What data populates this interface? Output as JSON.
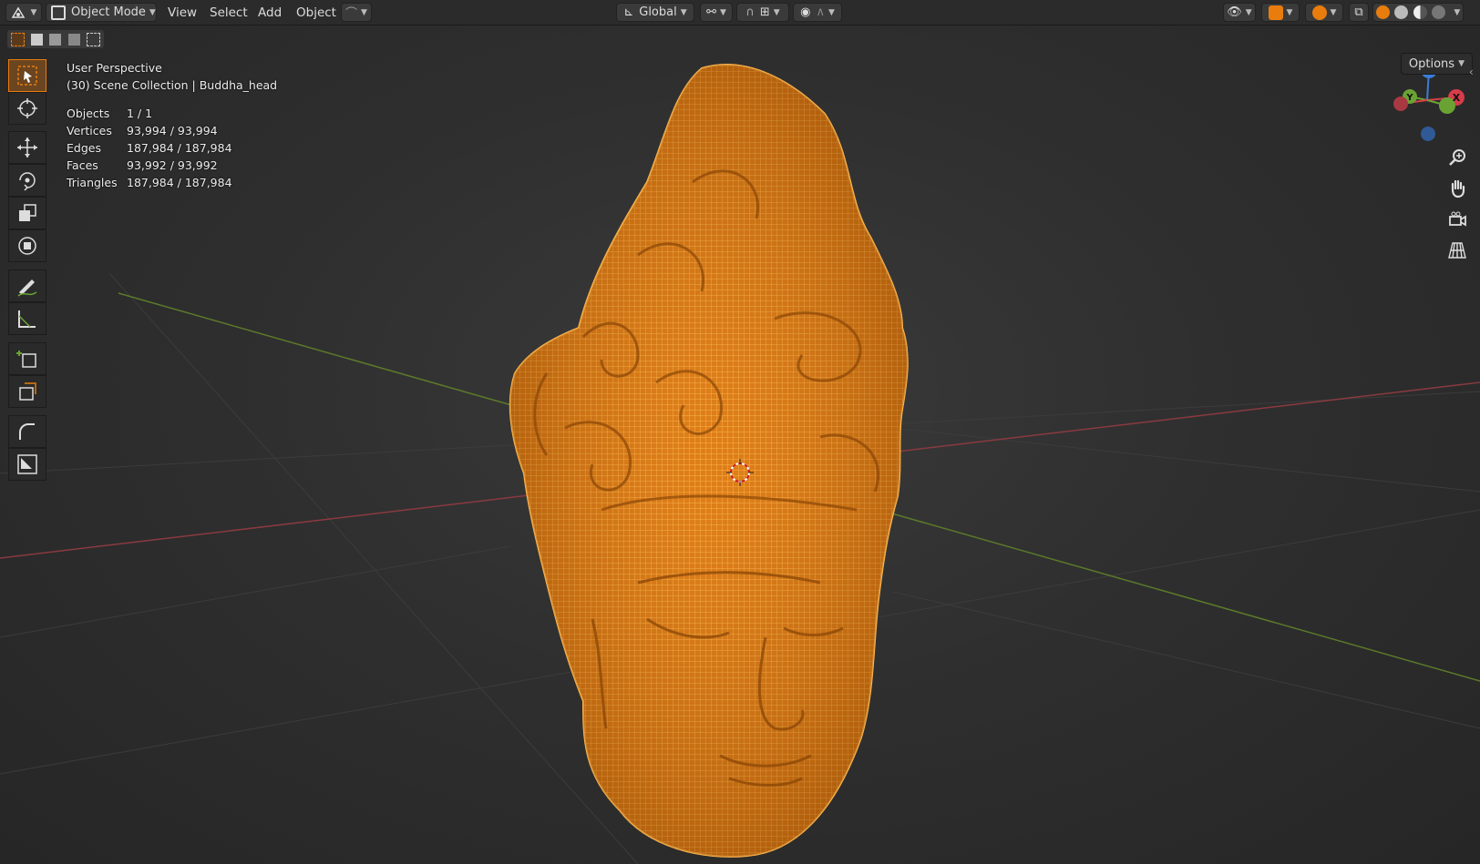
{
  "header": {
    "mode_label": "Object Mode",
    "menus": [
      "View",
      "Select",
      "Add",
      "Object"
    ],
    "orientation_label": "Global",
    "options_label": "Options"
  },
  "overlay": {
    "view_name": "User Perspective",
    "collection": "(30) Scene Collection | Buddha_head",
    "stats": [
      {
        "label": "Objects",
        "value": "1 / 1"
      },
      {
        "label": "Vertices",
        "value": "93,994 / 93,994"
      },
      {
        "label": "Edges",
        "value": "187,984 / 187,984"
      },
      {
        "label": "Faces",
        "value": "93,992 / 93,992"
      },
      {
        "label": "Triangles",
        "value": "187,984 / 187,984"
      }
    ]
  },
  "gizmo": {
    "z": "Z",
    "y": "Y",
    "x": "X"
  },
  "toolbar": {
    "tools": [
      "select-box",
      "cursor",
      "move",
      "rotate",
      "scale",
      "transform",
      "annotate",
      "measure",
      "add-cube",
      "extrude",
      "bend",
      "shrink"
    ]
  },
  "colors": {
    "accent": "#e87d0d",
    "wire": "#ffa12b",
    "axis_x": "#b0434a",
    "axis_y": "#6a8f2e",
    "gizmo_x": "#d63c4a",
    "gizmo_y": "#6aa334",
    "gizmo_z": "#3b7dd8"
  }
}
